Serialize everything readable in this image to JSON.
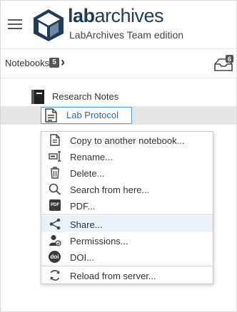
{
  "header": {
    "logo_text_bold": "lab",
    "logo_text_rest": "archives",
    "edition": "LabArchives Team edition"
  },
  "navbar": {
    "notebooks_label": "Notebooks",
    "notebooks_count": "5",
    "chevron": "›",
    "inbox_count": "6"
  },
  "tree": {
    "notebook": "Research Notes",
    "selected_page": "Lab Protocol"
  },
  "menu": {
    "items": [
      {
        "label": "Copy to another notebook...",
        "icon": "copy-icon"
      },
      {
        "label": "Rename...",
        "icon": "rename-icon"
      },
      {
        "label": "Delete...",
        "icon": "trash-icon"
      },
      {
        "label": "Search from here...",
        "icon": "search-icon"
      },
      {
        "label": "PDF...",
        "icon": "pdf-icon"
      },
      {
        "label": "Share...",
        "icon": "share-icon"
      },
      {
        "label": "Permissions...",
        "icon": "permissions-icon"
      },
      {
        "label": "DOI...",
        "icon": "doi-icon"
      },
      {
        "label": "Reload from server...",
        "icon": "reload-icon"
      }
    ],
    "pdf_badge": "PDF",
    "doi_badge": "doi"
  },
  "colors": {
    "brand": "#1f3d57",
    "selection_border": "#4aa0d6",
    "link": "#1e6fb0",
    "highlight": "#e7f1f7"
  }
}
